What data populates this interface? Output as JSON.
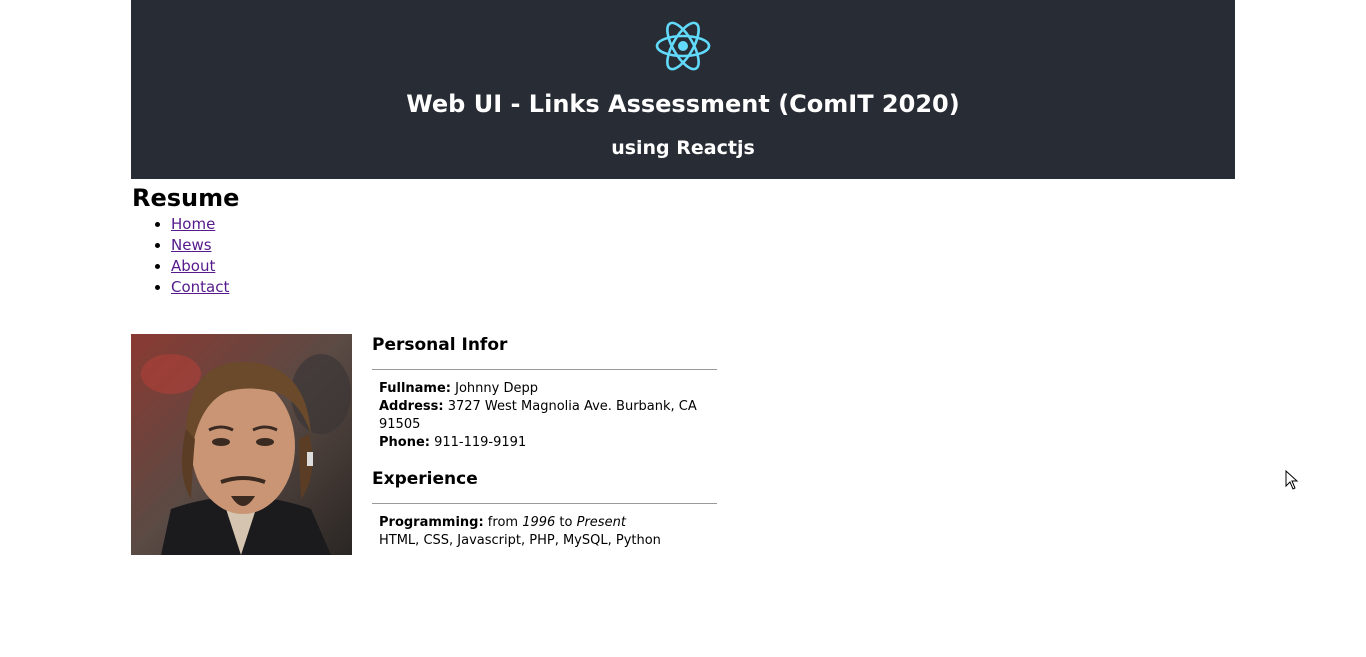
{
  "header": {
    "logo_icon": "react-atom-icon",
    "logo_color": "#61dafb",
    "background": "#282c34",
    "title": "Web UI - Links Assessment (ComIT 2020)",
    "subtitle": "using Reactjs"
  },
  "resume": {
    "heading": "Resume"
  },
  "nav": {
    "items": [
      {
        "label": "Home"
      },
      {
        "label": "News"
      },
      {
        "label": "About"
      },
      {
        "label": "Contact"
      }
    ]
  },
  "personal": {
    "title": "Personal Infor",
    "fullname_label": "Fullname:",
    "fullname": " Johnny Depp",
    "address_label": "Address:",
    "address": " 3727 West Magnolia Ave. Burbank, CA 91505",
    "phone_label": "Phone:",
    "phone": " 911-119-9191"
  },
  "experience": {
    "title": "Experience",
    "programming_label": "Programming:",
    "from_word": " from ",
    "from_year": "1996",
    "to_word": " to ",
    "to_value": "Present",
    "skills": "HTML, CSS, Javascript, PHP, MySQL, Python"
  }
}
